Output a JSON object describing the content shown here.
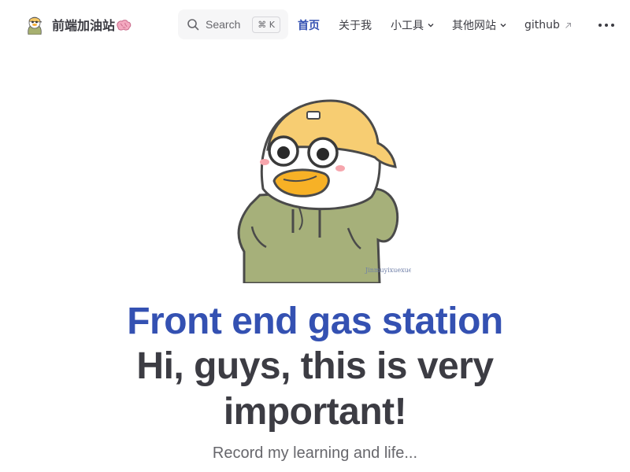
{
  "nav": {
    "site_title": "前端加油站",
    "search": {
      "label": "Search",
      "shortcut": "⌘ K"
    },
    "links": [
      {
        "label": "首页",
        "active": true
      },
      {
        "label": "关于我"
      },
      {
        "label": "小工具",
        "dropdown": true
      },
      {
        "label": "其他网站",
        "dropdown": true
      },
      {
        "label": "github",
        "external": true
      }
    ]
  },
  "hero": {
    "image_watermark": "Jinmuyixuexue",
    "name": "Front end gas station",
    "text": "Hi, guys, this is very important!",
    "tagline": "Record my learning and life..."
  },
  "colors": {
    "brand": "#3451b2",
    "text": "#3c3c43",
    "muted": "#67676c",
    "search_bg": "#f6f6f7"
  }
}
